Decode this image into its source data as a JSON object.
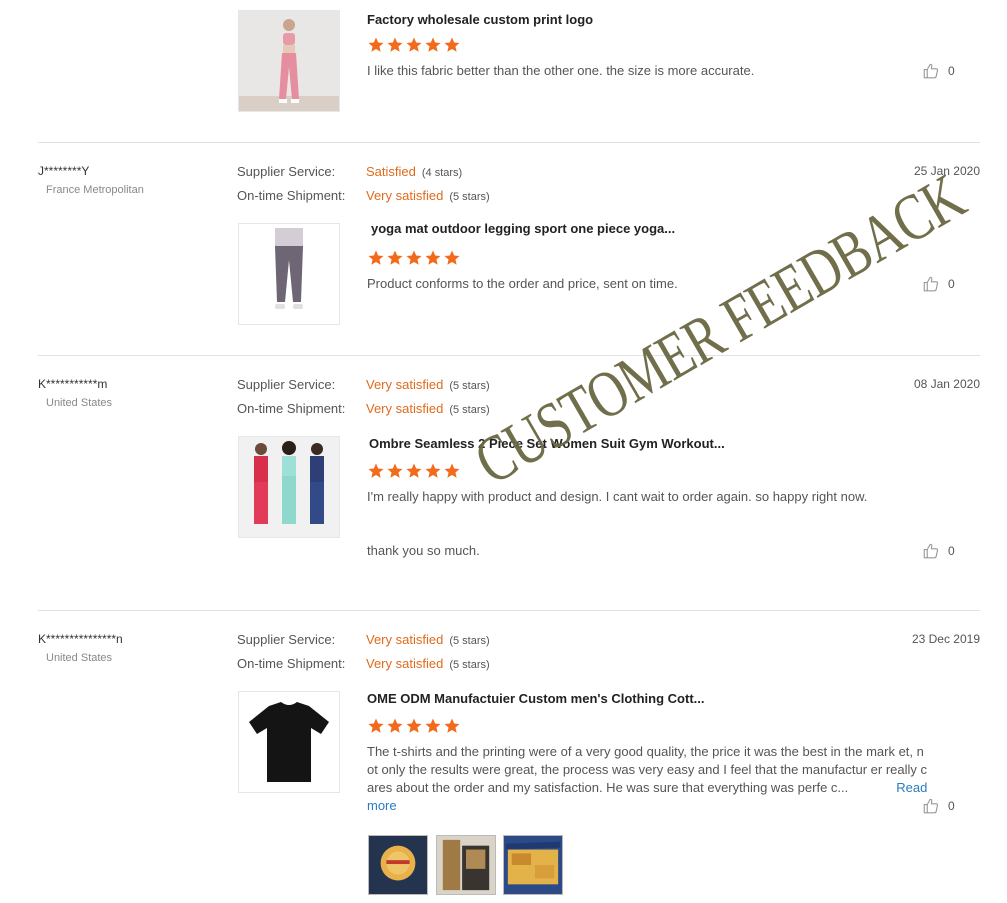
{
  "labels": {
    "supplier_service": "Supplier Service:",
    "ontime_shipment": "On-time Shipment:",
    "read_more": "Read more"
  },
  "colors": {
    "star": "#f26b1d",
    "rating_text": "#e06b1c",
    "link": "#2a7bc2",
    "watermark": "#6a6743"
  },
  "watermark": "CUSTOMER FEEDBACK",
  "reviews": [
    {
      "product_title": "Factory wholesale custom print logo",
      "product_image": "pink-workout-set-photo",
      "rating": 5,
      "comment": "I like this fabric better than the other one. the size is more accurate.",
      "likes": "0"
    },
    {
      "buyer": "J********Y",
      "country": "France Metropolitan",
      "date": "25 Jan 2020",
      "supplier_service": {
        "value": "Satisfied",
        "stars": "(4 stars)"
      },
      "ontime_shipment": {
        "value": "Very satisfied",
        "stars": "(5 stars)"
      },
      "product_title": "yoga mat outdoor legging sport one piece yoga...",
      "product_image": "grey-leggings-photo",
      "rating": 5,
      "comment": "Product conforms to the order and price, sent on time.",
      "likes": "0"
    },
    {
      "buyer": "K***********m",
      "country": "United States",
      "date": "08 Jan 2020",
      "supplier_service": {
        "value": "Very satisfied",
        "stars": "(5 stars)"
      },
      "ontime_shipment": {
        "value": "Very satisfied",
        "stars": "(5 stars)"
      },
      "product_title": "Ombre Seamless 2 Piece Set Women Suit Gym Workout...",
      "product_image": "three-models-photo",
      "rating": 5,
      "comment": "I'm really happy with product and design. I cant wait to order again. so happy right now.",
      "comment_extra": "thank you so much.",
      "likes": "0"
    },
    {
      "buyer": "K***************n",
      "country": "United States",
      "date": "23 Dec 2019",
      "supplier_service": {
        "value": "Very satisfied",
        "stars": "(5 stars)"
      },
      "ontime_shipment": {
        "value": "Very satisfied",
        "stars": "(5 stars)"
      },
      "product_title": "OME ODM Manufactuier Custom men's Clothing Cott...",
      "product_image": "black-tshirt-photo",
      "rating": 5,
      "comment": "The t-shirts and the printing were of a very good quality, the price it was the best in the mark et, not only the results were great, the process was very easy and I feel that the manufactur er really cares about the order and my satisfaction. He was sure that everything was perfe c...",
      "likes": "0",
      "photos": [
        "printed-logo-photo",
        "boxes-photo",
        "packaged-shirts-photo"
      ]
    }
  ]
}
